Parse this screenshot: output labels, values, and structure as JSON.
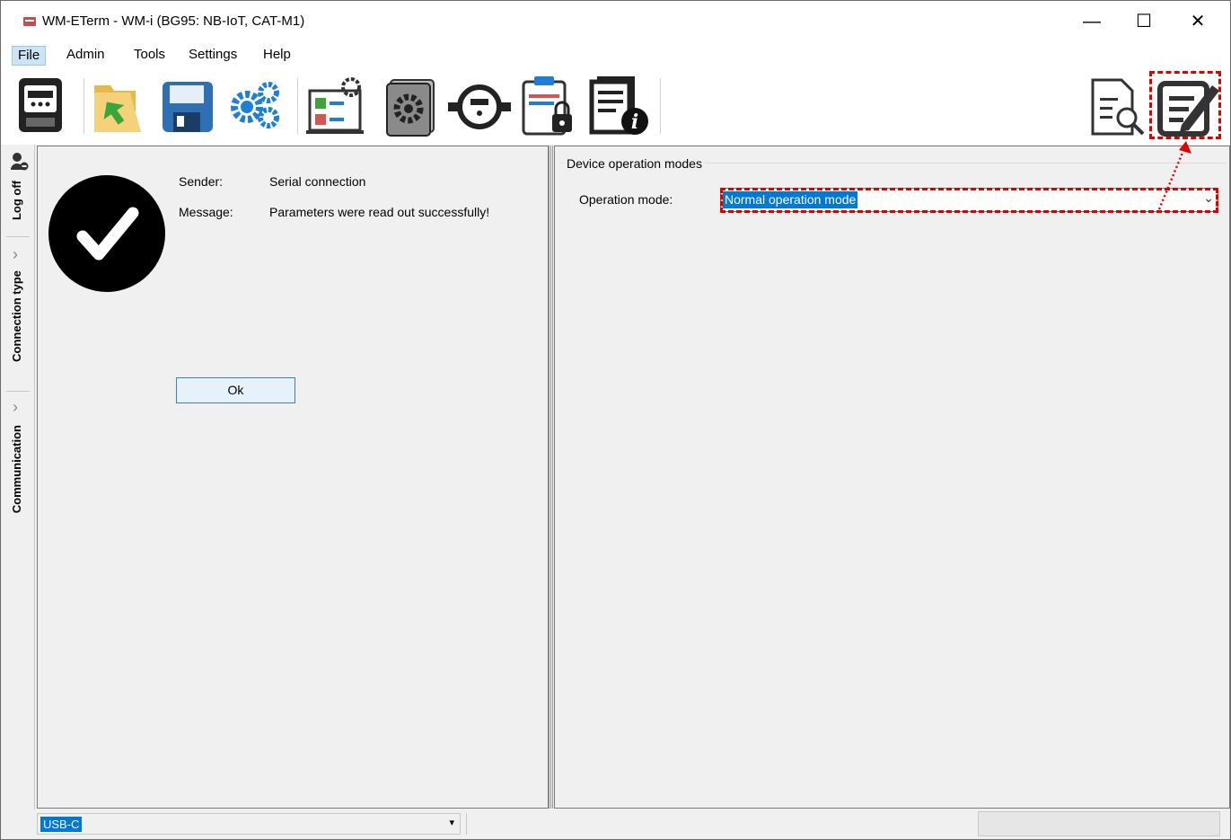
{
  "window": {
    "title": "WM-ETerm - WM-i (BG95: NB-IoT, CAT-M1)",
    "controls": {
      "minimize": "—",
      "maximize": "☐",
      "close": "✕"
    }
  },
  "menu": {
    "items": [
      "File",
      "Admin",
      "Tools",
      "Settings",
      "Help"
    ],
    "active": "File"
  },
  "toolbar": {
    "icons": [
      "meter-icon",
      "open-folder-icon",
      "save-icon",
      "settings-gears-icon",
      "checklist-config-icon",
      "firmware-icon",
      "water-meter-icon",
      "secure-clipboard-icon",
      "device-info-icon",
      "read-parameters-icon",
      "write-parameters-icon"
    ]
  },
  "sidebar": {
    "tabs": [
      "Log off",
      "Connection type",
      "Communication"
    ]
  },
  "message": {
    "sender_label": "Sender:",
    "sender_value": "Serial connection",
    "message_label": "Message:",
    "message_value": "Parameters were read out successfully!",
    "ok_label": "Ok"
  },
  "device": {
    "group_title": "Device operation modes",
    "mode_label": "Operation mode:",
    "mode_value": "Normal operation mode"
  },
  "status": {
    "port_value": "USB-C"
  },
  "colors": {
    "highlight": "#e00000",
    "selection": "#0078d7"
  }
}
